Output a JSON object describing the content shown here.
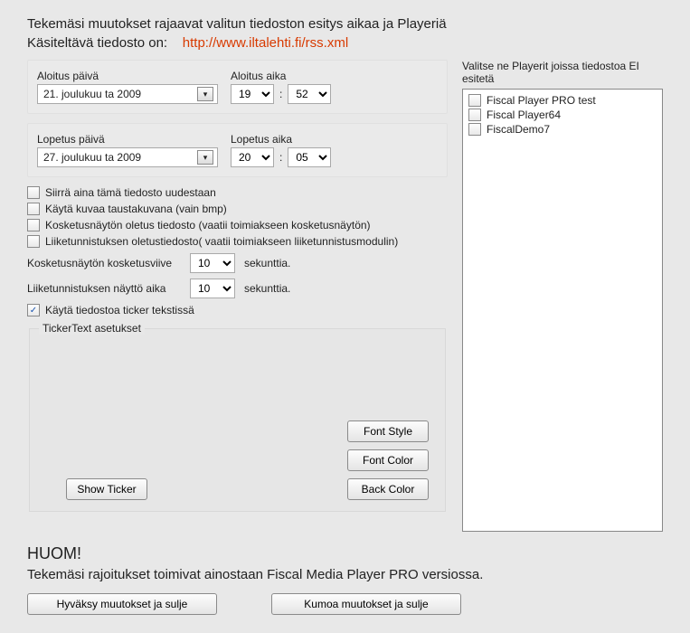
{
  "intro": {
    "line1": "Tekemäsi muutokset rajaavat valitun tiedoston esitys aikaa ja Playeriä",
    "line2_prefix": "Käsiteltävä tiedosto on:",
    "url": "http://www.iltalehti.fi/rss.xml"
  },
  "start": {
    "date_label": "Aloitus päivä",
    "date_value": "21.  joulukuu  ta 2009",
    "time_label": "Aloitus aika",
    "hour": "19",
    "minute": "52",
    "sep": ":"
  },
  "end": {
    "date_label": "Lopetus päivä",
    "date_value": "27.  joulukuu  ta 2009",
    "time_label": "Lopetus aika",
    "hour": "20",
    "minute": "05",
    "sep": ":"
  },
  "checks": {
    "c1": "Siirrä aina tämä tiedosto uudestaan",
    "c2": "Käytä kuvaa taustakuvana (vain bmp)",
    "c3": "Kosketusnäytön oletus tiedosto (vaatii toimiakseen kosketusnäytön)",
    "c4": "Liiketunnistuksen oletustiedosto( vaatii toimiakseen liiketunnistusmodulin)",
    "c5": "Käytä tiedostoa ticker tekstissä"
  },
  "params": {
    "p1_label": "Kosketusnäytön kosketusviive",
    "p1_value": "10",
    "p2_label": "Liiketunnistuksen näyttö aika",
    "p2_value": "10",
    "unit": "sekunttia."
  },
  "ticker": {
    "legend": "TickerText asetukset",
    "show": "Show Ticker",
    "font_style": "Font Style",
    "font_color": "Font Color",
    "back_color": "Back Color"
  },
  "players": {
    "label": "Valitse ne Playerit joissa tiedostoa EI esitetä",
    "items": [
      "Fiscal Player PRO test",
      "Fiscal Player64",
      "FiscalDemo7"
    ]
  },
  "bottom": {
    "huom": "HUOM!",
    "note": "Tekemäsi rajoitukset toimivat ainostaan Fiscal Media Player PRO versiossa.",
    "ok": "Hyväksy muutokset ja sulje",
    "cancel": "Kumoa muutokset ja sulje"
  }
}
